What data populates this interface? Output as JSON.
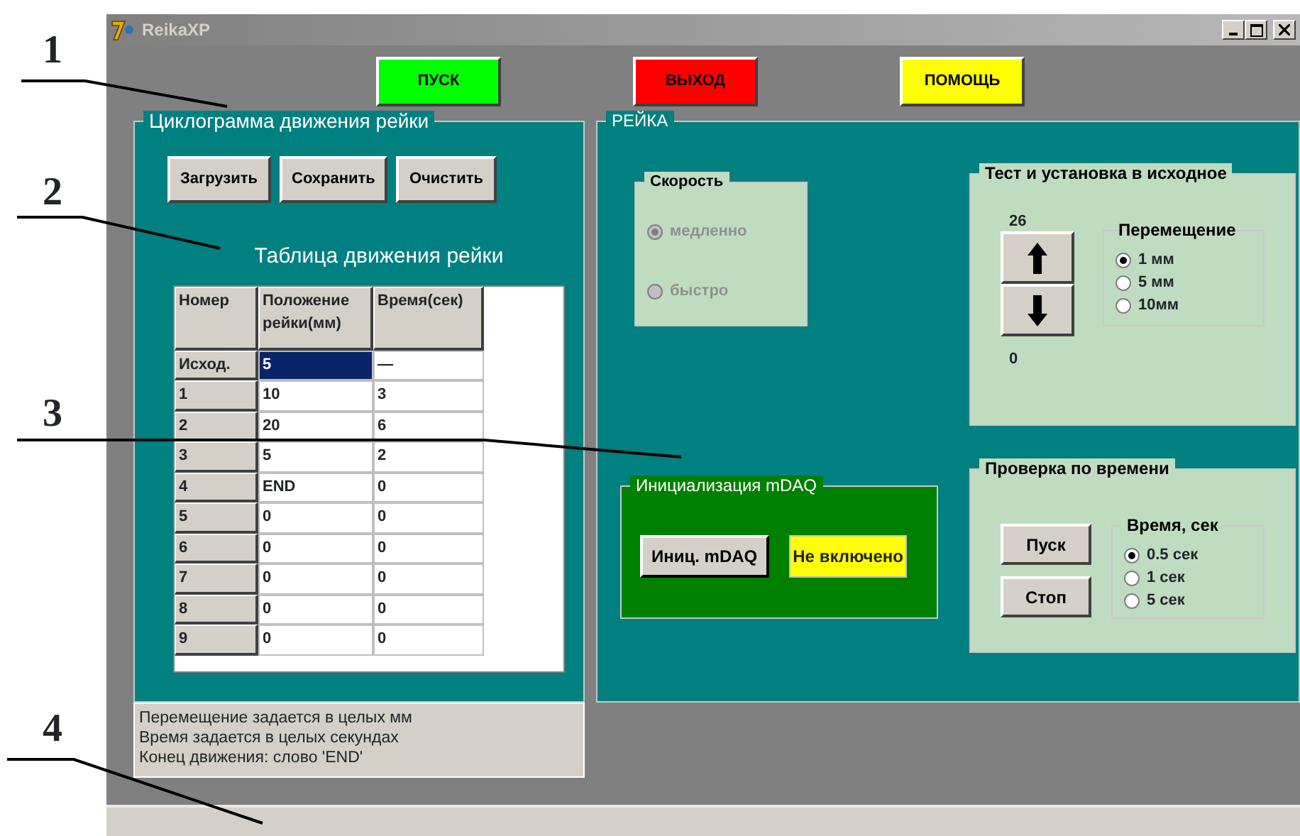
{
  "callouts": [
    {
      "label": "1"
    },
    {
      "label": "2"
    },
    {
      "label": "3"
    },
    {
      "label": "4"
    }
  ],
  "window": {
    "title": "ReikaXP"
  },
  "top_buttons": [
    {
      "label": "ПУСК",
      "color": "#00ff00"
    },
    {
      "label": "ВЫХОД",
      "color": "#ff0000"
    },
    {
      "label": "ПОМОЩЬ",
      "color": "#ffff00"
    }
  ],
  "cyclogram": {
    "title": "Циклограмма движения рейки",
    "buttons": [
      "Загрузить",
      "Сохранить",
      "Очистить"
    ],
    "table_title": "Таблица движения рейки",
    "table": {
      "columns": [
        "Номер",
        "Положение рейки(мм)",
        "Время(сек)"
      ],
      "rows": [
        {
          "cells": [
            "Исход.",
            "5",
            "—"
          ],
          "selected": true
        },
        {
          "cells": [
            "1",
            "10",
            "3"
          ],
          "selected": false
        },
        {
          "cells": [
            "2",
            "20",
            "6"
          ],
          "selected": false
        },
        {
          "cells": [
            "3",
            "5",
            "2"
          ],
          "selected": false
        },
        {
          "cells": [
            "4",
            "END",
            "0"
          ],
          "selected": false
        },
        {
          "cells": [
            "5",
            "0",
            "0"
          ],
          "selected": false
        },
        {
          "cells": [
            "6",
            "0",
            "0"
          ],
          "selected": false
        },
        {
          "cells": [
            "7",
            "0",
            "0"
          ],
          "selected": false
        },
        {
          "cells": [
            "8",
            "0",
            "0"
          ],
          "selected": false
        },
        {
          "cells": [
            "9",
            "0",
            "0"
          ],
          "selected": false
        }
      ]
    }
  },
  "info_lines": [
    "Перемещение задается в целых мм",
    "Время задается в целых секундах",
    "Конец движения: слово 'END'"
  ],
  "reika": {
    "title": "РЕЙКА",
    "speed": {
      "title": "Скорость",
      "disabled": true,
      "options": [
        {
          "label": "медленно",
          "selected": true
        },
        {
          "label": "быстро",
          "selected": false
        }
      ]
    },
    "test": {
      "title": "Тест и установка в исходное",
      "top_value": "26",
      "bottom_value": "0",
      "movement": {
        "title": "Перемещение",
        "options": [
          {
            "label": "1 мм",
            "selected": true
          },
          {
            "label": "5 мм",
            "selected": false
          },
          {
            "label": "10мм",
            "selected": false
          }
        ]
      }
    },
    "init": {
      "title": "Инициализация mDAQ",
      "button": "Иниц. mDAQ",
      "status": "Не включено"
    },
    "timing": {
      "title": "Проверка по времени",
      "buttons": [
        "Пуск",
        "Стоп"
      ],
      "time": {
        "title": "Время, сек",
        "options": [
          {
            "label": "0.5 сек",
            "selected": true
          },
          {
            "label": "1 сек",
            "selected": false
          },
          {
            "label": "5 сек",
            "selected": false
          }
        ]
      }
    }
  }
}
